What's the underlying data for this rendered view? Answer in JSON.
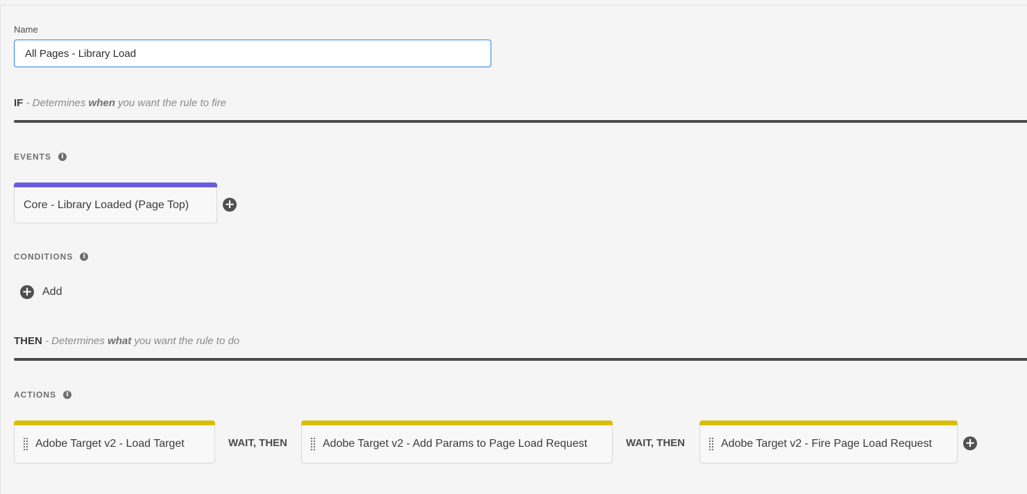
{
  "name_field": {
    "label": "Name",
    "value": "All Pages - Library Load"
  },
  "if_section": {
    "keyword": "IF",
    "desc_prefix": " - Determines ",
    "desc_bold": "when",
    "desc_suffix": " you want the rule to fire"
  },
  "events": {
    "label": "EVENTS",
    "items": [
      {
        "label": "Core - Library Loaded (Page Top)"
      }
    ]
  },
  "conditions": {
    "label": "CONDITIONS",
    "add_label": "Add"
  },
  "then_section": {
    "keyword": "THEN",
    "desc_prefix": " - Determines ",
    "desc_bold": "what",
    "desc_suffix": " you want the rule to do"
  },
  "actions": {
    "label": "ACTIONS",
    "items": [
      {
        "label": "Adobe Target v2 - Load Target"
      },
      {
        "label": "Adobe Target v2 - Add Params to Page Load Request"
      },
      {
        "label": "Adobe Target v2 - Fire Page Load Request"
      }
    ],
    "separator_label": "WAIT, THEN"
  },
  "icons": {
    "info": "info-icon",
    "add": "plus-circle-icon",
    "grip": "drag-handle-icon"
  },
  "colors": {
    "event_accent": "#6b5cdb",
    "action_accent": "#d9bd0a",
    "input_focus": "#2680eb"
  }
}
